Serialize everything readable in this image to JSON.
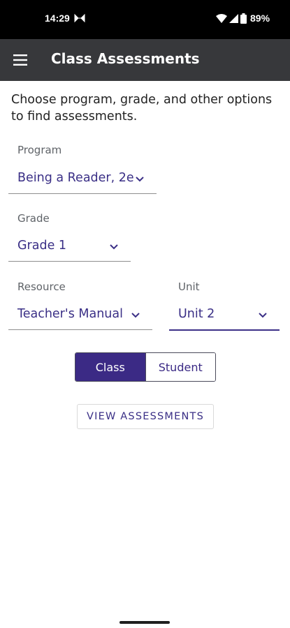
{
  "status_bar": {
    "time": "14:29",
    "battery": "89%",
    "icons": [
      "notification-icon",
      "wifi-icon",
      "signal-icon",
      "battery-icon"
    ]
  },
  "app_bar": {
    "title": "Class Assessments",
    "menu_icon": "menu-icon"
  },
  "intro_text": "Choose program, grade, and other options to find assessments.",
  "fields": {
    "program": {
      "label": "Program",
      "value": "Being a Reader, 2e"
    },
    "grade": {
      "label": "Grade",
      "value": "Grade 1"
    },
    "resource": {
      "label": "Resource",
      "value": "Teacher's Manual"
    },
    "unit": {
      "label": "Unit",
      "value": "Unit 2"
    }
  },
  "toggle": {
    "options": [
      "Class",
      "Student"
    ],
    "selected": "Class"
  },
  "actions": {
    "view_assessments": "VIEW ASSESSMENTS"
  },
  "colors": {
    "accent": "#3b2a85",
    "app_bar": "#37383b",
    "status_bar": "#000000"
  }
}
